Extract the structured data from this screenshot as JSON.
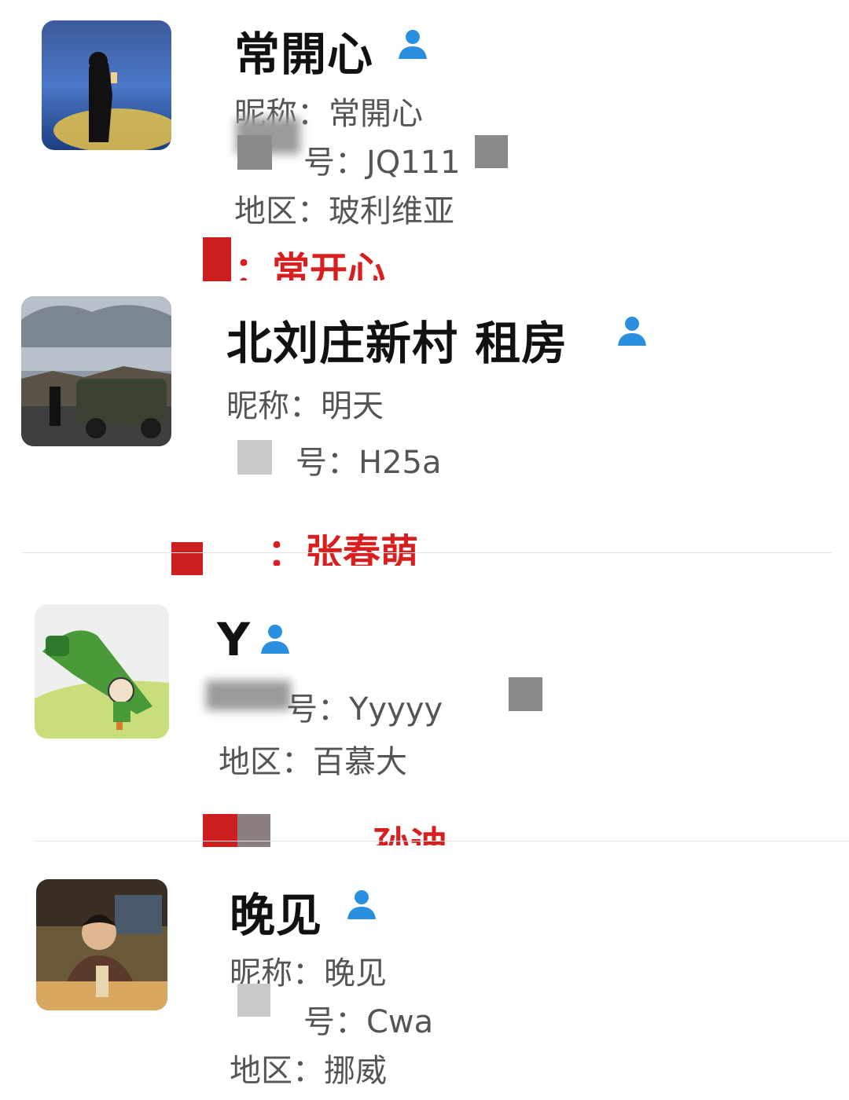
{
  "contacts": [
    {
      "name": "常開心",
      "nickname_label": "昵称：",
      "nickname": "常開心",
      "id_label": "号：",
      "id_value": "JQ111",
      "region_label": "地区：",
      "region": "玻利维亚",
      "note": "：常开心"
    },
    {
      "name": "北刘庄新村 租房",
      "nickname_label": "昵称：",
      "nickname": "明天",
      "id_label": "号：",
      "id_value": "H25a",
      "note": "：张春萌"
    },
    {
      "name": "Y",
      "id_label": "号：",
      "id_value": "Yyyyy",
      "region_label": "地区：",
      "region": "百慕大",
      "note": "孙迪"
    },
    {
      "name": "晚见",
      "nickname_label": "昵称：",
      "nickname": "晚见",
      "id_label": "号：",
      "id_value": "Cwa",
      "region_label": "地区：",
      "region": "挪威"
    }
  ],
  "colors": {
    "person_icon": "#2b8fe0",
    "note_red": "#d81e1e"
  },
  "icons": {
    "contact_type": "person-icon"
  }
}
